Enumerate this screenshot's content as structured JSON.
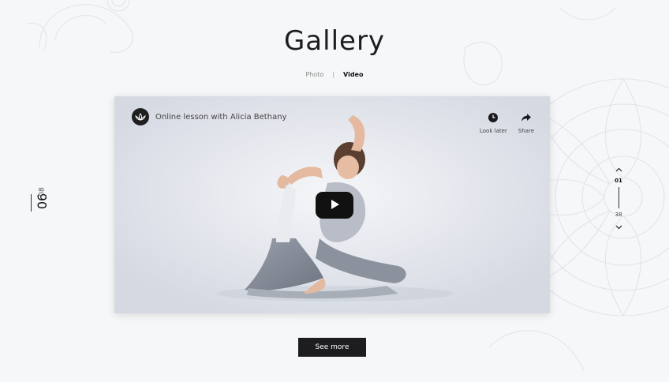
{
  "page": {
    "title": "Gallery"
  },
  "tabs": {
    "photo": "Photo",
    "separator": "|",
    "video": "Video",
    "active": "Video"
  },
  "side_counter": {
    "current": "06",
    "total": "08"
  },
  "video": {
    "title": "Online lesson with Alicia Bethany",
    "channel_icon": "lotus-icon",
    "actions": [
      {
        "label": "Look later",
        "icon": "clock-icon"
      },
      {
        "label": "Share",
        "icon": "share-icon"
      }
    ],
    "play_icon": "play-icon"
  },
  "pager": {
    "current": "01",
    "total": "38"
  },
  "see_more": "See more",
  "colors": {
    "background": "#f6f7f8",
    "dark": "#1d1d1f",
    "play": "#111111"
  }
}
